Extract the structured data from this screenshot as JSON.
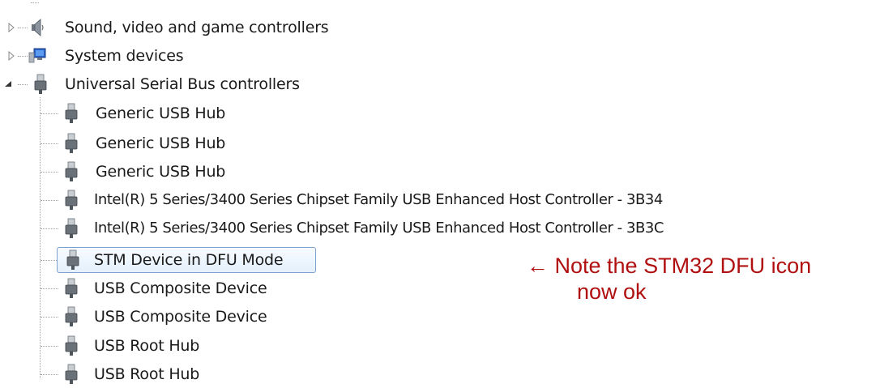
{
  "tree": {
    "categories": [
      {
        "label": "Sound, video and game controllers",
        "icon": "speaker-icon",
        "expanded": false
      },
      {
        "label": "System devices",
        "icon": "computer-icon",
        "expanded": false
      },
      {
        "label": "Universal Serial Bus controllers",
        "icon": "usb-plug-icon",
        "expanded": true
      }
    ],
    "usb_children": [
      {
        "label": "Generic USB Hub",
        "icon": "usb-plug-icon"
      },
      {
        "label": "Generic USB Hub",
        "icon": "usb-plug-icon"
      },
      {
        "label": "Generic USB Hub",
        "icon": "usb-plug-icon"
      },
      {
        "label": "Intel(R) 5 Series/3400 Series Chipset Family USB Enhanced Host Controller - 3B34",
        "icon": "usb-plug-icon"
      },
      {
        "label": "Intel(R) 5 Series/3400 Series Chipset Family USB Enhanced Host Controller - 3B3C",
        "icon": "usb-plug-icon"
      },
      {
        "label": "STM Device in DFU Mode",
        "icon": "usb-plug-icon",
        "selected": true
      },
      {
        "label": "USB Composite Device",
        "icon": "usb-plug-icon"
      },
      {
        "label": "USB Composite Device",
        "icon": "usb-plug-icon"
      },
      {
        "label": "USB Root Hub",
        "icon": "usb-plug-icon"
      },
      {
        "label": "USB Root Hub",
        "icon": "usb-plug-icon"
      }
    ]
  },
  "annotation": {
    "line1": "← Note the STM32 DFU icon",
    "line2": "now ok",
    "color": "#b01010"
  },
  "colors": {
    "selection_border": "#7da2ce",
    "selection_fill": "#e4f0fc"
  }
}
